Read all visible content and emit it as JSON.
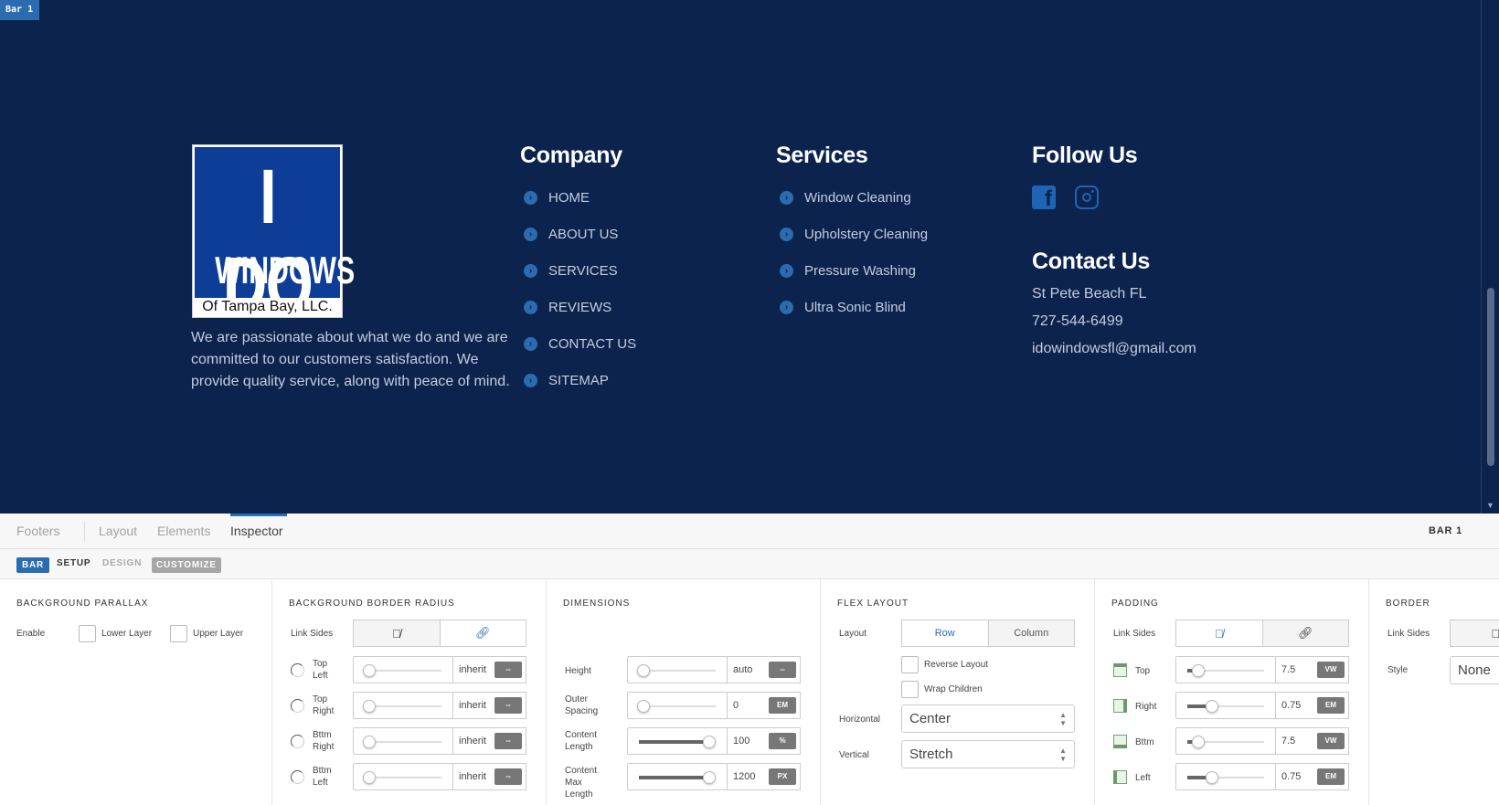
{
  "bar_tag": "Bar 1",
  "logo": {
    "line1": "I DO",
    "line2": "WINDOWS",
    "line3": "Of Tampa Bay, LLC."
  },
  "about_text": "We are passionate about what we do and we are committed to our customers satisfaction. We provide quality service, along with peace of mind.",
  "company": {
    "heading": "Company",
    "items": [
      "HOME",
      "ABOUT US",
      "SERVICES",
      "REVIEWS",
      "CONTACT US",
      "SITEMAP"
    ]
  },
  "services": {
    "heading": "Services",
    "items": [
      "Window Cleaning",
      "Upholstery Cleaning",
      "Pressure Washing",
      "Ultra Sonic Blind"
    ]
  },
  "follow": {
    "heading": "Follow Us",
    "icons": [
      "facebook-icon",
      "instagram-icon"
    ]
  },
  "contact": {
    "heading": "Contact Us",
    "location": "St Pete Beach FL",
    "phone": "727-544-6499",
    "email": "idowindowsfl@gmail.com"
  },
  "colors": {
    "canvas_bg": "#0c234e",
    "accent": "#2b6cb0",
    "text_light": "#c3cde0"
  },
  "tabs": {
    "footers": "Footers",
    "layout": "Layout",
    "elements": "Elements",
    "inspector": "Inspector",
    "bar_label": "BAR 1"
  },
  "subtabs": {
    "bar": "BAR",
    "setup": "SETUP",
    "design": "DESIGN",
    "customize": "CUSTOMIZE"
  },
  "bg_parallax": {
    "title": "BACKGROUND PARALLAX",
    "enable": "Enable",
    "lower": "Lower Layer",
    "upper": "Upper Layer"
  },
  "bg_radius": {
    "title": "BACKGROUND BORDER RADIUS",
    "link_sides": "Link Sides",
    "rows": [
      {
        "l1": "Top",
        "l2": "Left",
        "value": "inherit",
        "unit": "--"
      },
      {
        "l1": "Top",
        "l2": "Right",
        "value": "inherit",
        "unit": "--"
      },
      {
        "l1": "Bttm",
        "l2": "Right",
        "value": "inherit",
        "unit": "--"
      },
      {
        "l1": "Bttm",
        "l2": "Left",
        "value": "inherit",
        "unit": "--"
      }
    ]
  },
  "dimensions": {
    "title": "DIMENSIONS",
    "rows": [
      {
        "l1": "Height",
        "l2": "",
        "value": "auto",
        "unit": "--",
        "level": 0
      },
      {
        "l1": "Outer",
        "l2": "Spacing",
        "value": "0",
        "unit": "EM",
        "level": 0
      },
      {
        "l1": "Content",
        "l2": "Length",
        "value": "100",
        "unit": "%",
        "level": 1
      },
      {
        "l1": "Content",
        "l2": "Max Length",
        "value": "1200",
        "unit": "PX",
        "level": 1
      }
    ]
  },
  "flex": {
    "title": "FLEX LAYOUT",
    "layout": "Layout",
    "row": "Row",
    "column": "Column",
    "reverse": "Reverse Layout",
    "wrap": "Wrap Children",
    "horizontal": "Horizontal",
    "horizontal_value": "Center",
    "vertical": "Vertical",
    "vertical_value": "Stretch"
  },
  "padding": {
    "title": "PADDING",
    "link_sides": "Link Sides",
    "rows": [
      {
        "label": "Top",
        "value": "7.5",
        "unit": "VW",
        "level": 0.1
      },
      {
        "label": "Right",
        "value": "0.75",
        "unit": "EM",
        "level": 0.3
      },
      {
        "label": "Bttm",
        "value": "7.5",
        "unit": "VW",
        "level": 0.1
      },
      {
        "label": "Left",
        "value": "0.75",
        "unit": "EM",
        "level": 0.3
      }
    ]
  },
  "border": {
    "title": "BORDER",
    "link_sides": "Link Sides",
    "style": "Style",
    "style_value": "None"
  }
}
